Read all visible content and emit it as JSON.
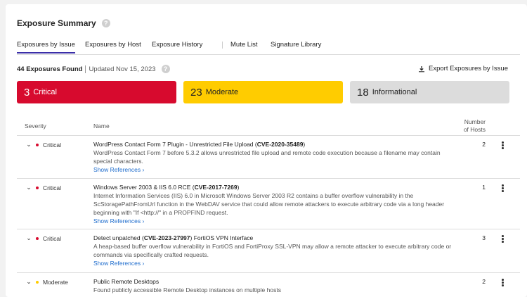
{
  "header": {
    "title": "Exposure Summary"
  },
  "tabs": [
    {
      "label": "Exposures by Issue",
      "active": true
    },
    {
      "label": "Exposures by Host",
      "active": false
    },
    {
      "label": "Exposure History",
      "active": false
    },
    {
      "label": "Mute List",
      "active": false
    },
    {
      "label": "Signature Library",
      "active": false
    }
  ],
  "summary": {
    "found": "44 Exposures Found",
    "updated": "Updated Nov 15, 2023",
    "export_label": "Export Exposures by Issue"
  },
  "cards": [
    {
      "count": "3",
      "label": "Critical",
      "color": "#d70a2e"
    },
    {
      "count": "23",
      "label": "Moderate",
      "color": "#ffcc00"
    },
    {
      "count": "18",
      "label": "Informational",
      "color": "#dcdcdc"
    }
  ],
  "table": {
    "columns": {
      "severity": "Severity",
      "name": "Name",
      "hosts_line1": "Number",
      "hosts_line2": "of Hosts"
    },
    "rows": [
      {
        "severity": "Critical",
        "severity_color": "#d70a2e",
        "title_pre": "WordPress Contact Form 7 Plugin - Unrestricted File Upload (",
        "cve": "CVE-2020-35489",
        "title_post": ")",
        "description": "WordPress Contact Form 7 before 5.3.2 allows unrestricted file upload and remote code execution because a filename may contain special characters.",
        "show_refs": "Show References",
        "hosts": "2"
      },
      {
        "severity": "Critical",
        "severity_color": "#d70a2e",
        "title_pre": "Windows Server 2003 & IIS 6.0 RCE (",
        "cve": "CVE-2017-7269",
        "title_post": ")",
        "description": "Internet Information Services (IIS) 6.0 in Microsoft Windows Server 2003 R2 contains a buffer overflow vulnerability in the ScStoragePathFromUrl function in the WebDAV service that could allow remote attackers to execute arbitrary code via a long header beginning with \"If <http://\" in a PROPFIND request.",
        "show_refs": "Show References",
        "hosts": "1"
      },
      {
        "severity": "Critical",
        "severity_color": "#d70a2e",
        "title_pre": "Detect unpatched (",
        "cve": "CVE-2023-27997",
        "title_post": ") FortiOS VPN Interface",
        "description": "A heap-based buffer overflow vulnerability in FortiOS and FortiProxy SSL-VPN may allow a remote attacker to execute arbitrary code or commands via specifically crafted requests.",
        "show_refs": "Show References",
        "hosts": "3"
      },
      {
        "severity": "Moderate",
        "severity_color": "#ffcc00",
        "title_pre": "Public Remote Desktops",
        "cve": "",
        "title_post": "",
        "description": "Found publicly accessible Remote Desktop instances on multiple hosts",
        "show_refs": "",
        "hosts": "2"
      }
    ]
  }
}
